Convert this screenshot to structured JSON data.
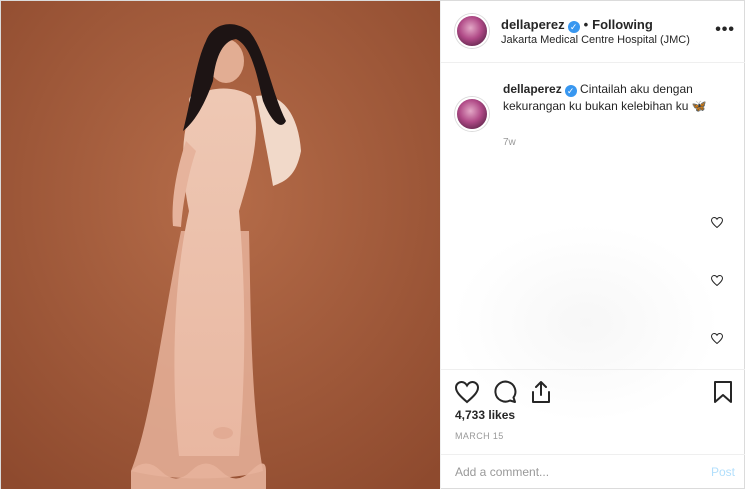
{
  "photo": {
    "alt_icon": "photo-image",
    "background": "#a9603f"
  },
  "header": {
    "username": "dellaperez",
    "separator": "•",
    "follow_status": "Following",
    "location": "Jakarta Medical Centre Hospital (JMC)",
    "more_icon": "more-options-icon",
    "more_label": "•••"
  },
  "caption": {
    "username": "dellaperez",
    "text": "Cintailah aku dengan kekurangan ku bukan kelebihan ku 🦋",
    "time": "7w"
  },
  "comments": {
    "like_icons": [
      "heart-outline-icon",
      "heart-outline-icon",
      "heart-outline-icon"
    ]
  },
  "actions": {
    "icons": [
      "heart-icon",
      "comment-icon",
      "share-icon",
      "bookmark-icon"
    ],
    "likes": "4,733 likes",
    "date": "MARCH 15"
  },
  "comment_box": {
    "placeholder": "Add a comment...",
    "post_label": "Post"
  },
  "colors": {
    "verified": "#3897f0",
    "post_disabled": "#b2dffc",
    "muted": "#999999"
  }
}
